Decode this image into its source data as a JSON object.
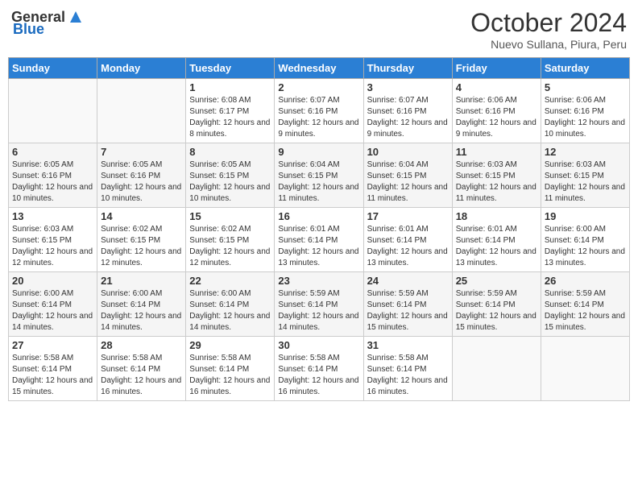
{
  "header": {
    "logo_general": "General",
    "logo_blue": "Blue",
    "month_year": "October 2024",
    "location": "Nuevo  Sullana, Piura, Peru"
  },
  "calendar": {
    "days_of_week": [
      "Sunday",
      "Monday",
      "Tuesday",
      "Wednesday",
      "Thursday",
      "Friday",
      "Saturday"
    ],
    "weeks": [
      [
        {
          "day": "",
          "info": ""
        },
        {
          "day": "",
          "info": ""
        },
        {
          "day": "1",
          "info": "Sunrise: 6:08 AM\nSunset: 6:17 PM\nDaylight: 12 hours and 8 minutes."
        },
        {
          "day": "2",
          "info": "Sunrise: 6:07 AM\nSunset: 6:16 PM\nDaylight: 12 hours and 9 minutes."
        },
        {
          "day": "3",
          "info": "Sunrise: 6:07 AM\nSunset: 6:16 PM\nDaylight: 12 hours and 9 minutes."
        },
        {
          "day": "4",
          "info": "Sunrise: 6:06 AM\nSunset: 6:16 PM\nDaylight: 12 hours and 9 minutes."
        },
        {
          "day": "5",
          "info": "Sunrise: 6:06 AM\nSunset: 6:16 PM\nDaylight: 12 hours and 10 minutes."
        }
      ],
      [
        {
          "day": "6",
          "info": "Sunrise: 6:05 AM\nSunset: 6:16 PM\nDaylight: 12 hours and 10 minutes."
        },
        {
          "day": "7",
          "info": "Sunrise: 6:05 AM\nSunset: 6:16 PM\nDaylight: 12 hours and 10 minutes."
        },
        {
          "day": "8",
          "info": "Sunrise: 6:05 AM\nSunset: 6:15 PM\nDaylight: 12 hours and 10 minutes."
        },
        {
          "day": "9",
          "info": "Sunrise: 6:04 AM\nSunset: 6:15 PM\nDaylight: 12 hours and 11 minutes."
        },
        {
          "day": "10",
          "info": "Sunrise: 6:04 AM\nSunset: 6:15 PM\nDaylight: 12 hours and 11 minutes."
        },
        {
          "day": "11",
          "info": "Sunrise: 6:03 AM\nSunset: 6:15 PM\nDaylight: 12 hours and 11 minutes."
        },
        {
          "day": "12",
          "info": "Sunrise: 6:03 AM\nSunset: 6:15 PM\nDaylight: 12 hours and 11 minutes."
        }
      ],
      [
        {
          "day": "13",
          "info": "Sunrise: 6:03 AM\nSunset: 6:15 PM\nDaylight: 12 hours and 12 minutes."
        },
        {
          "day": "14",
          "info": "Sunrise: 6:02 AM\nSunset: 6:15 PM\nDaylight: 12 hours and 12 minutes."
        },
        {
          "day": "15",
          "info": "Sunrise: 6:02 AM\nSunset: 6:15 PM\nDaylight: 12 hours and 12 minutes."
        },
        {
          "day": "16",
          "info": "Sunrise: 6:01 AM\nSunset: 6:14 PM\nDaylight: 12 hours and 13 minutes."
        },
        {
          "day": "17",
          "info": "Sunrise: 6:01 AM\nSunset: 6:14 PM\nDaylight: 12 hours and 13 minutes."
        },
        {
          "day": "18",
          "info": "Sunrise: 6:01 AM\nSunset: 6:14 PM\nDaylight: 12 hours and 13 minutes."
        },
        {
          "day": "19",
          "info": "Sunrise: 6:00 AM\nSunset: 6:14 PM\nDaylight: 12 hours and 13 minutes."
        }
      ],
      [
        {
          "day": "20",
          "info": "Sunrise: 6:00 AM\nSunset: 6:14 PM\nDaylight: 12 hours and 14 minutes."
        },
        {
          "day": "21",
          "info": "Sunrise: 6:00 AM\nSunset: 6:14 PM\nDaylight: 12 hours and 14 minutes."
        },
        {
          "day": "22",
          "info": "Sunrise: 6:00 AM\nSunset: 6:14 PM\nDaylight: 12 hours and 14 minutes."
        },
        {
          "day": "23",
          "info": "Sunrise: 5:59 AM\nSunset: 6:14 PM\nDaylight: 12 hours and 14 minutes."
        },
        {
          "day": "24",
          "info": "Sunrise: 5:59 AM\nSunset: 6:14 PM\nDaylight: 12 hours and 15 minutes."
        },
        {
          "day": "25",
          "info": "Sunrise: 5:59 AM\nSunset: 6:14 PM\nDaylight: 12 hours and 15 minutes."
        },
        {
          "day": "26",
          "info": "Sunrise: 5:59 AM\nSunset: 6:14 PM\nDaylight: 12 hours and 15 minutes."
        }
      ],
      [
        {
          "day": "27",
          "info": "Sunrise: 5:58 AM\nSunset: 6:14 PM\nDaylight: 12 hours and 15 minutes."
        },
        {
          "day": "28",
          "info": "Sunrise: 5:58 AM\nSunset: 6:14 PM\nDaylight: 12 hours and 16 minutes."
        },
        {
          "day": "29",
          "info": "Sunrise: 5:58 AM\nSunset: 6:14 PM\nDaylight: 12 hours and 16 minutes."
        },
        {
          "day": "30",
          "info": "Sunrise: 5:58 AM\nSunset: 6:14 PM\nDaylight: 12 hours and 16 minutes."
        },
        {
          "day": "31",
          "info": "Sunrise: 5:58 AM\nSunset: 6:14 PM\nDaylight: 12 hours and 16 minutes."
        },
        {
          "day": "",
          "info": ""
        },
        {
          "day": "",
          "info": ""
        }
      ]
    ]
  }
}
